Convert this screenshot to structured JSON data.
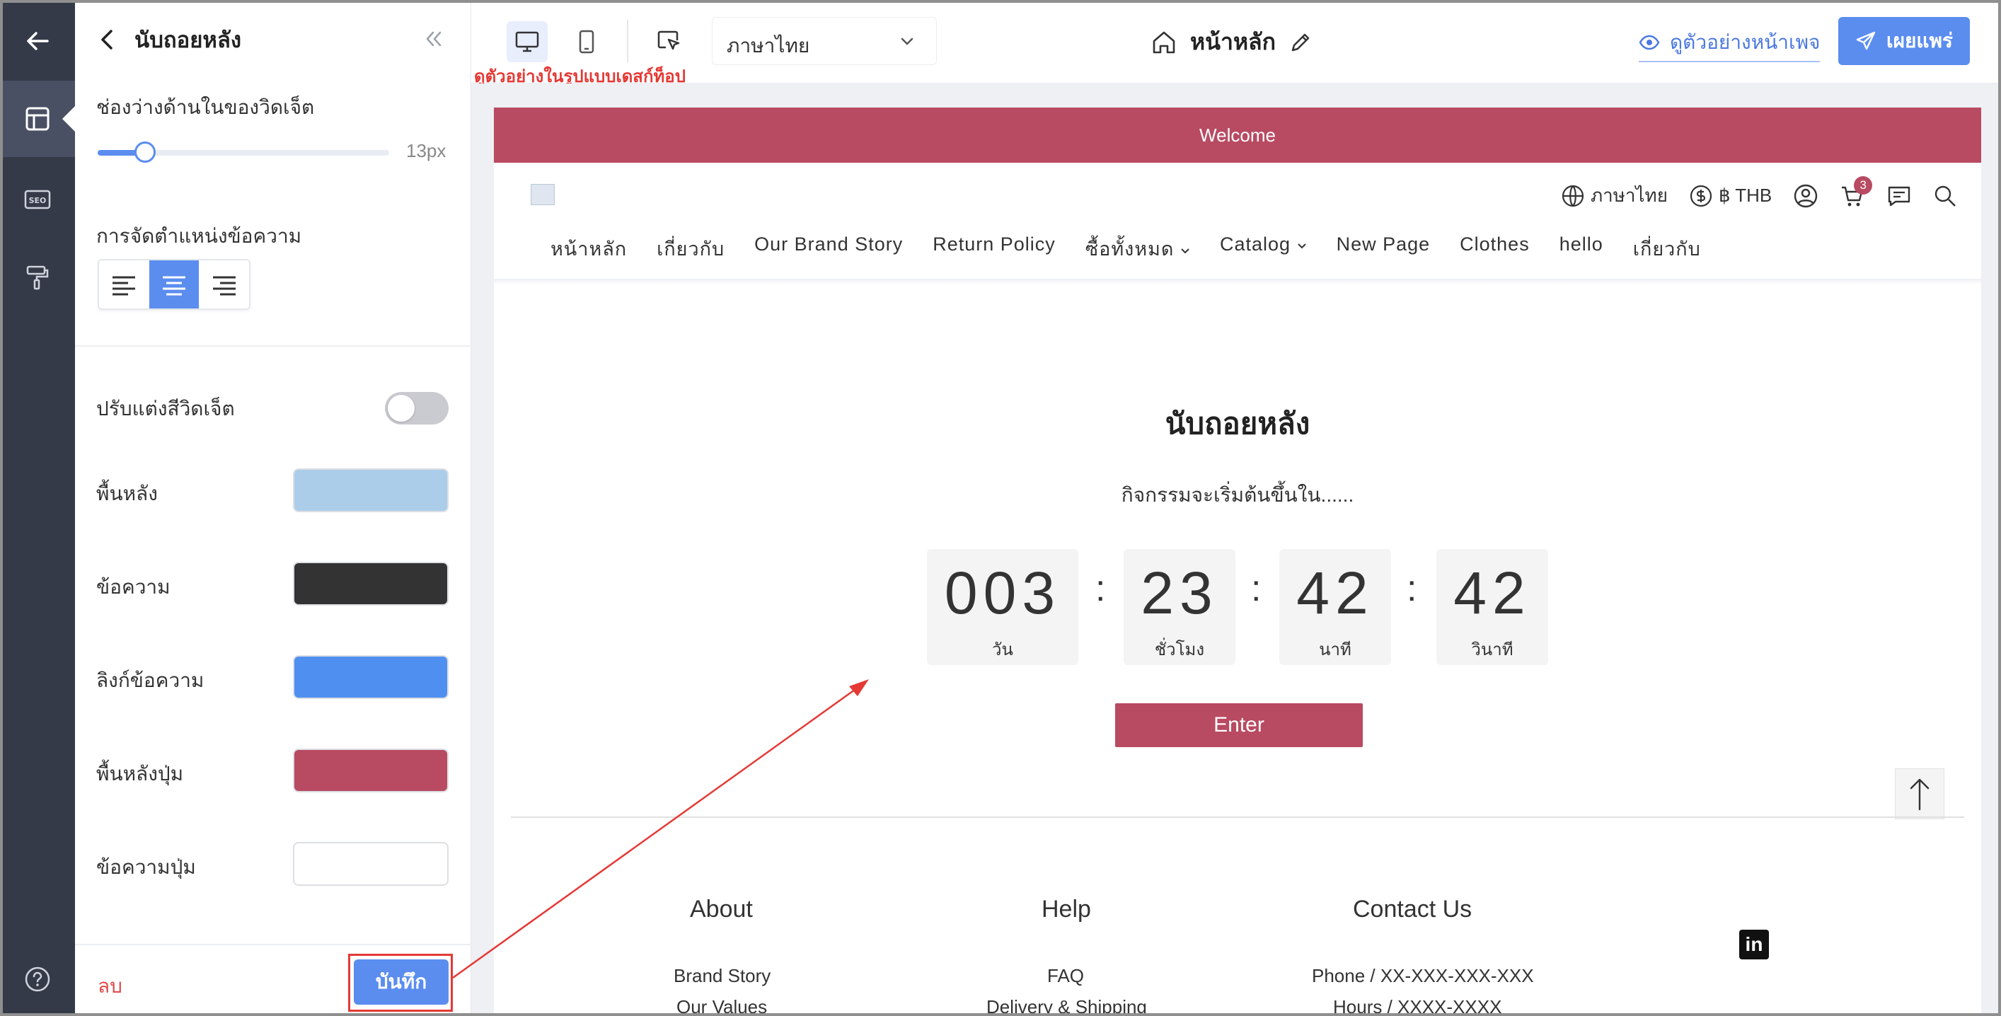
{
  "panel": {
    "title": "นับถอยหลัง",
    "padding_label": "ช่องว่างด้านในของวิดเจ็ต",
    "padding_value": "13px",
    "padding_fraction": 0.13,
    "align_label": "การจัดตำแหน่งข้อความ",
    "align_selected": "center",
    "custom_color_label": "ปรับแต่งสีวิดเจ็ต",
    "custom_color_enabled": false,
    "colors": [
      {
        "label": "พื้นหลัง",
        "value": "#abcdea"
      },
      {
        "label": "ข้อความ",
        "value": "#333333"
      },
      {
        "label": "ลิงก์ข้อความ",
        "value": "#4f8ff0"
      },
      {
        "label": "พื้นหลังปุ่ม",
        "value": "#b84a62"
      },
      {
        "label": "ข้อความปุ่ม",
        "value": "#ffffff"
      }
    ],
    "delete_label": "ลบ",
    "save_label": "บันทึก"
  },
  "topbar": {
    "language": "ภาษาไทย",
    "desktop_hint": "ดูตัวอย่างในรูปแบบเดสก์ท็อป",
    "page_title": "หน้าหลัก",
    "preview_label": "ดูตัวอย่างหน้าเพจ",
    "publish_label": "เผยแพร่"
  },
  "site": {
    "welcome": "Welcome",
    "language": "ภาษาไทย",
    "currency": "฿ THB",
    "cart_count": "3",
    "nav": [
      "หน้าหลัก",
      "เกี่ยวกับ",
      "Our Brand Story",
      "Return Policy",
      "ซื้อทั้งหมด",
      "Catalog",
      "New Page",
      "Clothes",
      "hello",
      "เกี่ยวกับ"
    ],
    "countdown": {
      "title": "นับถอยหลัง",
      "subtitle": "กิจกรรมจะเริ่มต้นขึ้นใน......",
      "days": "003",
      "days_label": "วัน",
      "hours": "23",
      "hours_label": "ชั่วโมง",
      "minutes": "42",
      "minutes_label": "นาที",
      "seconds": "42",
      "seconds_label": "วินาที",
      "button": "Enter"
    },
    "footer": {
      "about": "About",
      "help": "Help",
      "contact": "Contact Us",
      "about_links": [
        "Brand Story",
        "Our Values"
      ],
      "help_links": [
        "FAQ",
        "Delivery & Shipping"
      ],
      "contact_lines": [
        "Phone / XX-XXX-XXX-XXX",
        "Hours / XXXX-XXXX"
      ]
    }
  },
  "theme": {
    "accent": "#5b8def",
    "brand": "#b84a62",
    "rail_bg": "#353a49",
    "annotation": "#e53935"
  }
}
